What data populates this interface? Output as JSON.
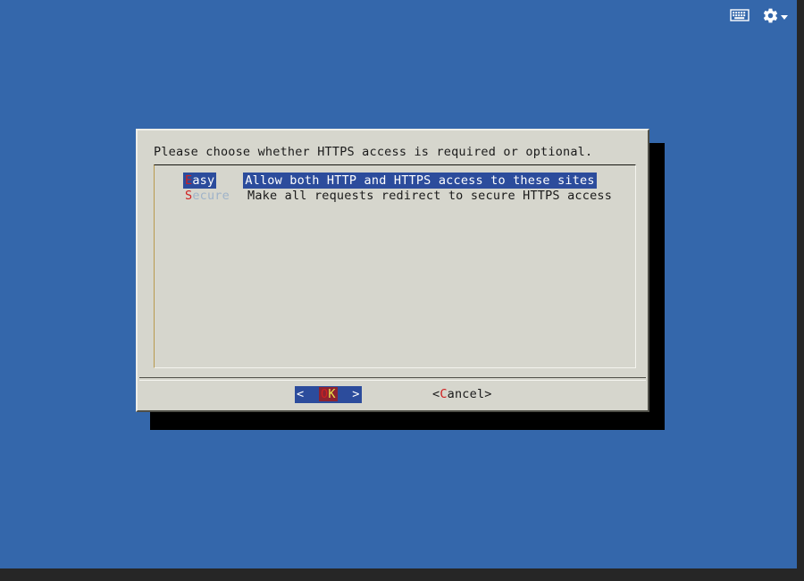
{
  "desktop": {
    "background_color": "#3467ab",
    "gutter_color": "#262626"
  },
  "toolbar": {
    "keyboard_icon": "keyboard-icon",
    "gear_icon": "gear-icon",
    "caret_icon": "chevron-down-icon"
  },
  "dialog": {
    "prompt": "Please choose whether HTTPS access is required or optional.",
    "background_color": "#d6d6cd",
    "highlight_color": "#2c4c9c",
    "hotkey_color": "#cf2020",
    "listbox": {
      "options": [
        {
          "tag_hot": "E",
          "tag_rest": "asy",
          "tag_full": "Easy",
          "description": "Allow both HTTP and HTTPS access to these sites",
          "selected": true
        },
        {
          "tag_hot": "S",
          "tag_rest": "ecure",
          "tag_full": "Secure",
          "description": "Make all requests redirect to secure HTTPS access",
          "selected": false
        }
      ]
    },
    "buttons": {
      "ok": {
        "left_bracket": "<",
        "pad_left": "  ",
        "letter_o": "O",
        "letter_k": "K",
        "pad_right": "  ",
        "right_bracket": ">"
      },
      "cancel": {
        "left_bracket": "<",
        "hot": "C",
        "rest": "ancel",
        "right_bracket": ">"
      }
    }
  }
}
